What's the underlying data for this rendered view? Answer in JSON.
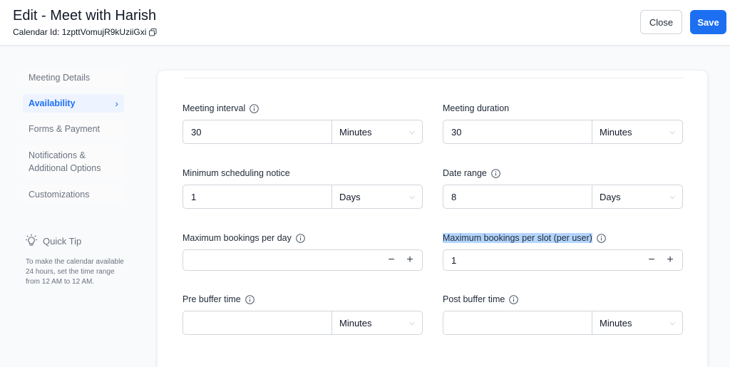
{
  "header": {
    "title": "Edit - Meet with Harish",
    "calendar_id": "Calendar Id: 1zpttVomujR9kUziiGxi",
    "close_label": "Close",
    "save_label": "Save"
  },
  "sidebar": {
    "items": [
      {
        "label": "Meeting Details"
      },
      {
        "label": "Availability",
        "active": true
      },
      {
        "label": "Forms & Payment"
      },
      {
        "label": "Notifications & Additional Options"
      },
      {
        "label": "Customizations"
      }
    ]
  },
  "quick_tip": {
    "title": "Quick Tip",
    "text": "To make the calendar available 24 hours, set the time range from 12 AM to 12 AM."
  },
  "form": {
    "meeting_interval": {
      "label": "Meeting interval",
      "value": "30",
      "unit": "Minutes"
    },
    "meeting_duration": {
      "label": "Meeting duration",
      "value": "30",
      "unit": "Minutes"
    },
    "min_notice": {
      "label": "Minimum scheduling notice",
      "value": "1",
      "unit": "Days"
    },
    "date_range": {
      "label": "Date range",
      "value": "8",
      "unit": "Days"
    },
    "max_per_day": {
      "label": "Maximum bookings per day",
      "value": ""
    },
    "max_per_slot": {
      "label": "Maximum bookings per slot (per user)",
      "value": "1"
    },
    "pre_buffer": {
      "label": "Pre buffer time",
      "value": "",
      "unit": "Minutes"
    },
    "post_buffer": {
      "label": "Post buffer time",
      "value": "",
      "unit": "Minutes"
    }
  },
  "icons": {
    "decrement": "−",
    "increment": "+",
    "caret": "⌵",
    "chevron": "›"
  },
  "colors": {
    "accent": "#1d6ff2",
    "selection": "#b4d5fe"
  }
}
